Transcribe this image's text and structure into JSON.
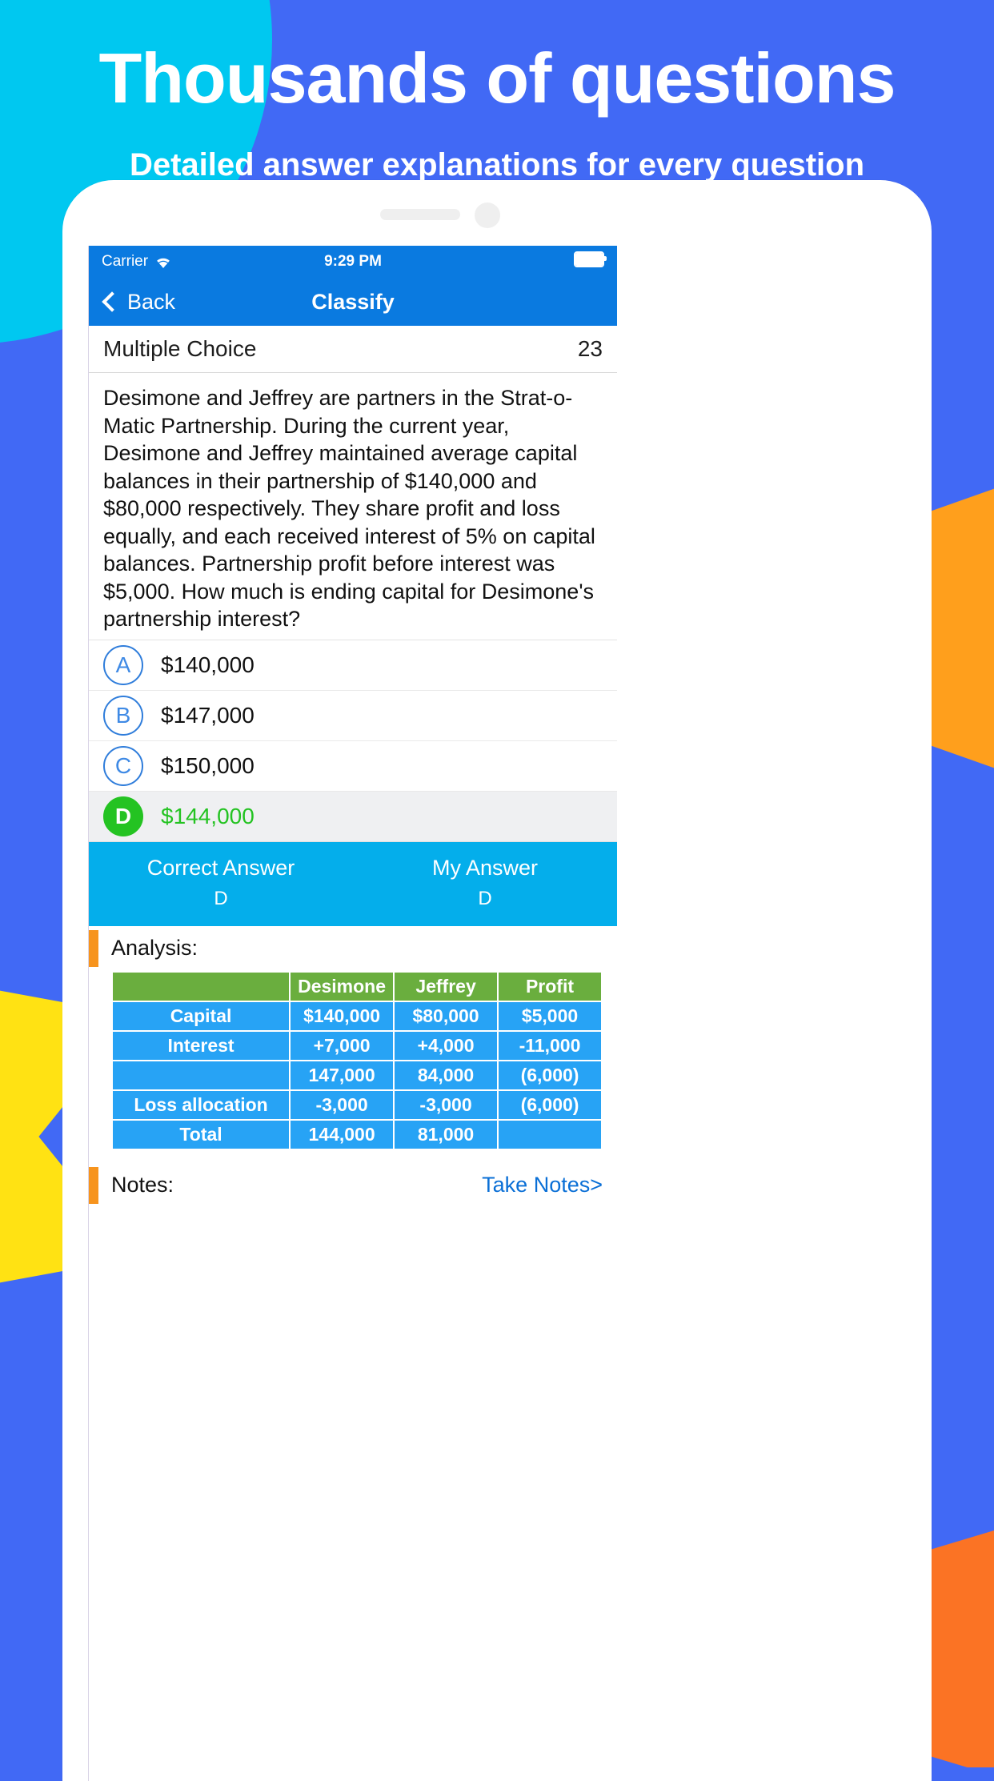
{
  "promo": {
    "headline": "Thousands of questions",
    "subheadline": "Detailed answer explanations for every question",
    "bg_color": "#4169f5",
    "accent_cyan": "#00c8f0",
    "accent_orange": "#ff9f1c",
    "accent_yellow": "#ffe213"
  },
  "status_bar": {
    "carrier": "Carrier",
    "wifi_icon": "wifi-icon",
    "time": "9:29 PM",
    "battery_icon": "battery-full-icon",
    "bg_color": "#0a7ae0"
  },
  "nav_bar": {
    "back_label": "Back",
    "back_icon": "chevron-left-icon",
    "title": "Classify"
  },
  "section": {
    "label": "Multiple Choice",
    "count": "23"
  },
  "question": {
    "text": "Desimone and Jeffrey are partners in the Strat-o-Matic Partnership. During the current year, Desimone and Jeffrey maintained average capital balances in their partnership of $140,000 and $80,000 respectively. They share profit and loss equally, and each received interest of 5% on capital balances. Partnership profit before interest was $5,000. How much is ending capital for Desimone's partnership interest?"
  },
  "options": [
    {
      "letter": "A",
      "text": "$140,000",
      "selected": false,
      "correct": false
    },
    {
      "letter": "B",
      "text": "$147,000",
      "selected": false,
      "correct": false
    },
    {
      "letter": "C",
      "text": "$150,000",
      "selected": false,
      "correct": false
    },
    {
      "letter": "D",
      "text": "$144,000",
      "selected": true,
      "correct": true
    }
  ],
  "answer_strip": {
    "correct_label": "Correct Answer",
    "correct_value": "D",
    "my_label": "My Answer",
    "my_value": "D",
    "bg_color": "#04aeeb"
  },
  "analysis": {
    "label": "Analysis:",
    "accent_color": "#f7941d"
  },
  "chart_data": {
    "type": "table",
    "title": "Analysis",
    "header_color": "#6aae3e",
    "body_color": "#27a3f5",
    "columns": [
      "",
      "Desimone",
      "Jeffrey",
      "Profit"
    ],
    "rows": [
      [
        "Capital",
        "$140,000",
        "$80,000",
        "$5,000"
      ],
      [
        "Interest",
        "+7,000",
        "+4,000",
        "-11,000"
      ],
      [
        "",
        "147,000",
        "84,000",
        "(6,000)"
      ],
      [
        "Loss  allocation",
        "-3,000",
        "-3,000",
        "(6,000)"
      ],
      [
        "Total",
        "144,000",
        "81,000",
        ""
      ]
    ]
  },
  "notes": {
    "label": "Notes:",
    "link": "Take Notes>"
  }
}
